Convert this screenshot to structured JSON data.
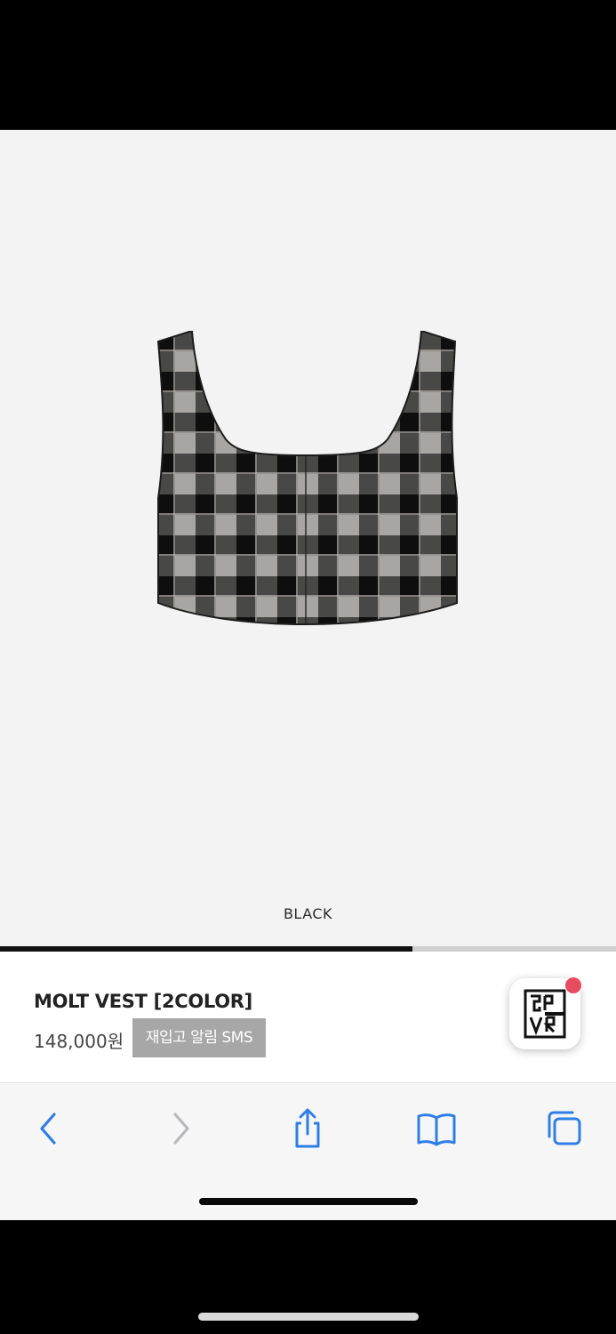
{
  "product": {
    "color_label": "BLACK",
    "title": "MOLT VEST [2COLOR]",
    "price": "148,000원",
    "restock_button": "재입고 알림 SMS",
    "image_icon": "plaid-crop-vest-image",
    "gallery_progress": 0.67
  },
  "app_badge": {
    "icon": "brand-logo-icon",
    "badge_color": "#e84a5f"
  },
  "toolbar": {
    "back_icon": "chevron-left-icon",
    "forward_icon": "chevron-right-icon",
    "share_icon": "share-icon",
    "bookmarks_icon": "book-icon",
    "tabs_icon": "tabs-icon",
    "accent": "#2f7ee8"
  }
}
